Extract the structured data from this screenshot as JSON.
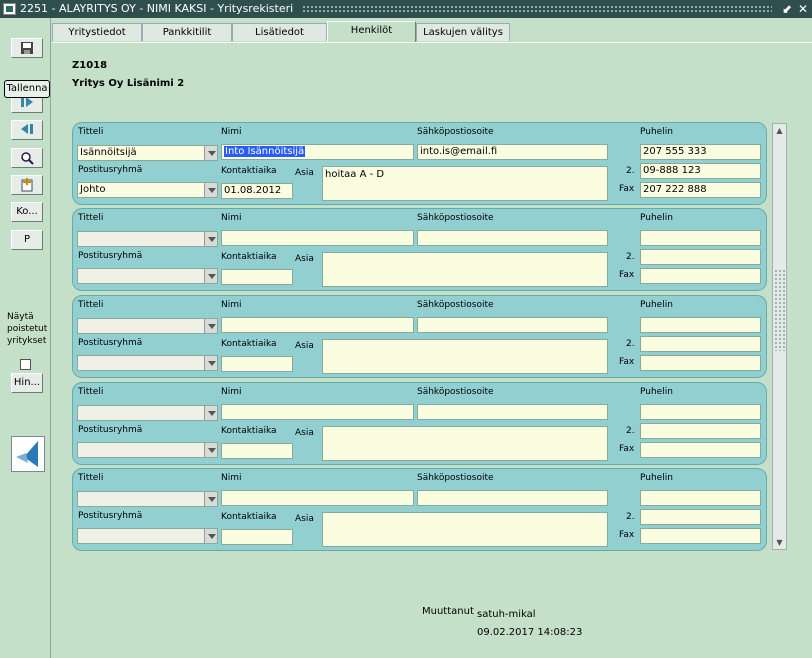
{
  "window": {
    "title": "2251 - ALAYRITYS OY - NIMI KAKSI - Yritysrekisteri",
    "minimize_glyph": "⬋",
    "close_glyph": "✕"
  },
  "toolbar": {
    "tooltip": "Tallenna",
    "ko_label": "Ko...",
    "p_label": "P",
    "hin_label": "Hin...",
    "show_deleted_label": "Näytä poistetut yritykset"
  },
  "tabs": [
    "Yritystiedot",
    "Pankkitilit",
    "Lisätiedot",
    "Henkilöt",
    "Laskujen välitys"
  ],
  "active_tab": 3,
  "company": {
    "code": "Z1018",
    "name": "Yritys Oy Lisänimi 2"
  },
  "labels": {
    "titteli": "Titteli",
    "nimi": "Nimi",
    "email": "Sähköpostiosoite",
    "puhelin": "Puhelin",
    "postitusryhma": "Postitusryhmä",
    "kontaktiaika": "Kontaktiaika",
    "asia": "Asia",
    "phone2": "2.",
    "fax": "Fax"
  },
  "persons": [
    {
      "titteli": "Isännöitsijä",
      "nimi": "Into Isännöitsijä",
      "email": "into.is@email.fi",
      "puhelin": "207 555 333",
      "postitusryhma": "Johto",
      "kontaktiaika": "01.08.2012",
      "asia": "hoitaa A - D",
      "puhelin2": "09-888 123",
      "fax": "207 222 888"
    },
    {
      "titteli": "",
      "nimi": "",
      "email": "",
      "puhelin": "",
      "postitusryhma": "",
      "kontaktiaika": "",
      "asia": "",
      "puhelin2": "",
      "fax": ""
    },
    {
      "titteli": "",
      "nimi": "",
      "email": "",
      "puhelin": "",
      "postitusryhma": "",
      "kontaktiaika": "",
      "asia": "",
      "puhelin2": "",
      "fax": ""
    },
    {
      "titteli": "",
      "nimi": "",
      "email": "",
      "puhelin": "",
      "postitusryhma": "",
      "kontaktiaika": "",
      "asia": "",
      "puhelin2": "",
      "fax": ""
    },
    {
      "titteli": "",
      "nimi": "",
      "email": "",
      "puhelin": "",
      "postitusryhma": "",
      "kontaktiaika": "",
      "asia": "",
      "puhelin2": "",
      "fax": ""
    }
  ],
  "footer": {
    "modified_label": "Muuttanut",
    "modified_by": "satuh-mikal",
    "modified_at": "09.02.2017 14:08:23"
  }
}
